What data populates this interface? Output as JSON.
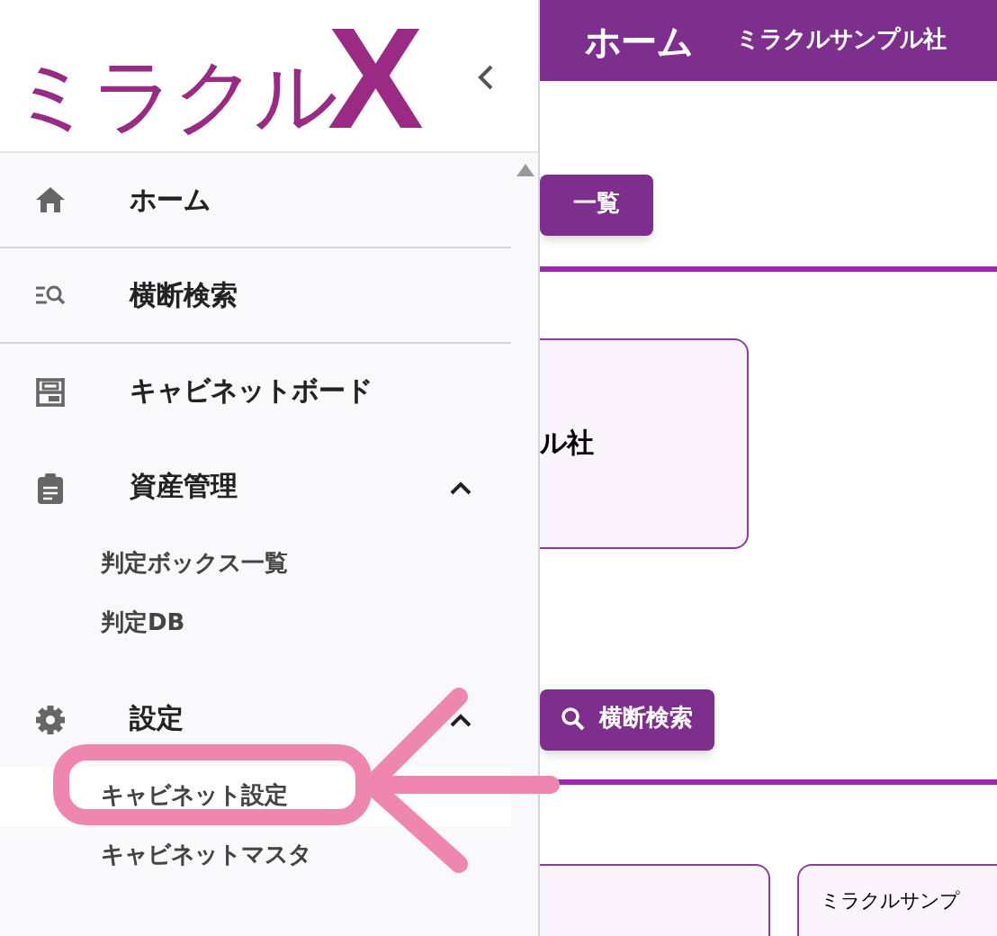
{
  "logo": {
    "text": "ミラクル",
    "mark": "X"
  },
  "sidebar": {
    "items": [
      {
        "label": "ホーム",
        "kind": "home",
        "divider": true
      },
      {
        "label": "横断検索",
        "kind": "search",
        "divider": true
      },
      {
        "label": "キャビネットボード",
        "kind": "board",
        "divider": false
      },
      {
        "label": "資産管理",
        "kind": "assets",
        "expanded": true,
        "children": [
          {
            "label": "判定ボックス一覧",
            "highlighted": false
          },
          {
            "label": "判定DB",
            "highlighted": false
          }
        ]
      },
      {
        "label": "設定",
        "kind": "settings",
        "expanded": true,
        "children": [
          {
            "label": "キャビネット設定",
            "highlighted": true
          },
          {
            "label": "キャビネットマスタ",
            "highlighted": false
          }
        ]
      }
    ]
  },
  "header": {
    "title": "ホーム",
    "company": "ミラクルサンプル社"
  },
  "main": {
    "list_button": "一覧",
    "card_1": "ル社",
    "search_button": "横断検索",
    "card_3": "ミラクルサンプ"
  }
}
